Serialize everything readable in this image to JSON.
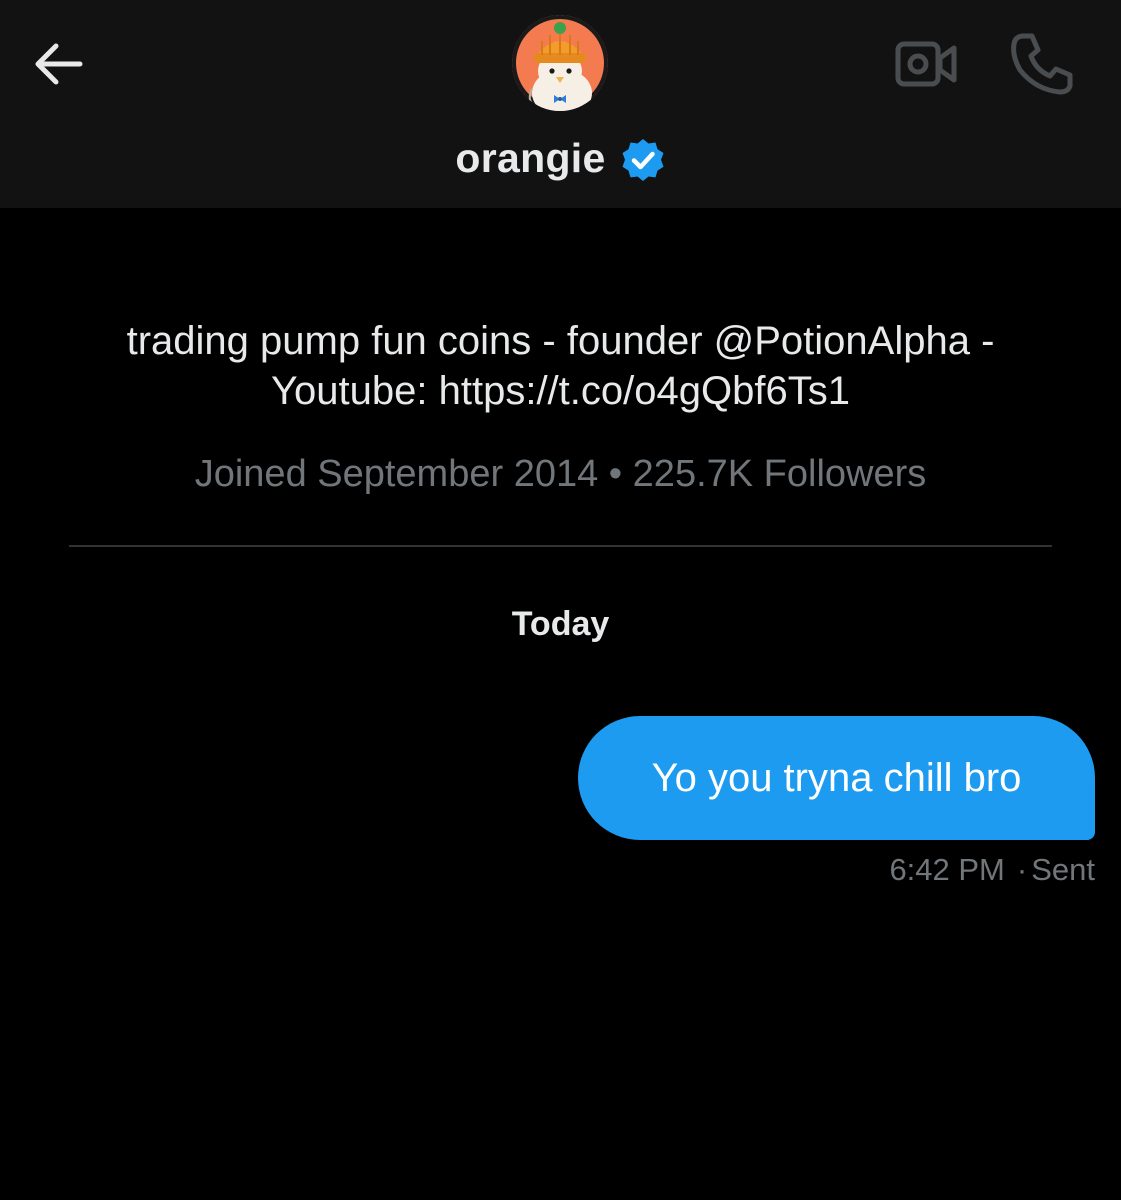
{
  "header": {
    "back_icon": "arrow-left-icon",
    "video_icon": "video-camera-icon",
    "call_icon": "phone-icon",
    "avatar_alt": "orangie avatar",
    "name": "orangie",
    "verified_icon": "verified-badge-icon",
    "verified_color": "#1d9bf0"
  },
  "profile": {
    "bio_line1": "trading pump fun coins - founder @PotionAlpha -",
    "bio_line2": "Youtube: https://t.co/o4gQbf6Ts1",
    "joined": "Joined September 2014",
    "separator": "•",
    "followers": "225.7K Followers"
  },
  "conversation": {
    "date_label": "Today",
    "messages": [
      {
        "text": "Yo you tryna chill bro",
        "time": "6:42 PM",
        "status_separator": "·",
        "status": "Sent"
      }
    ]
  },
  "colors": {
    "background": "#000000",
    "header_background": "#121212",
    "bubble": "#1d9bf0",
    "muted_text": "#71767b",
    "primary_text": "#e7e9ea"
  }
}
